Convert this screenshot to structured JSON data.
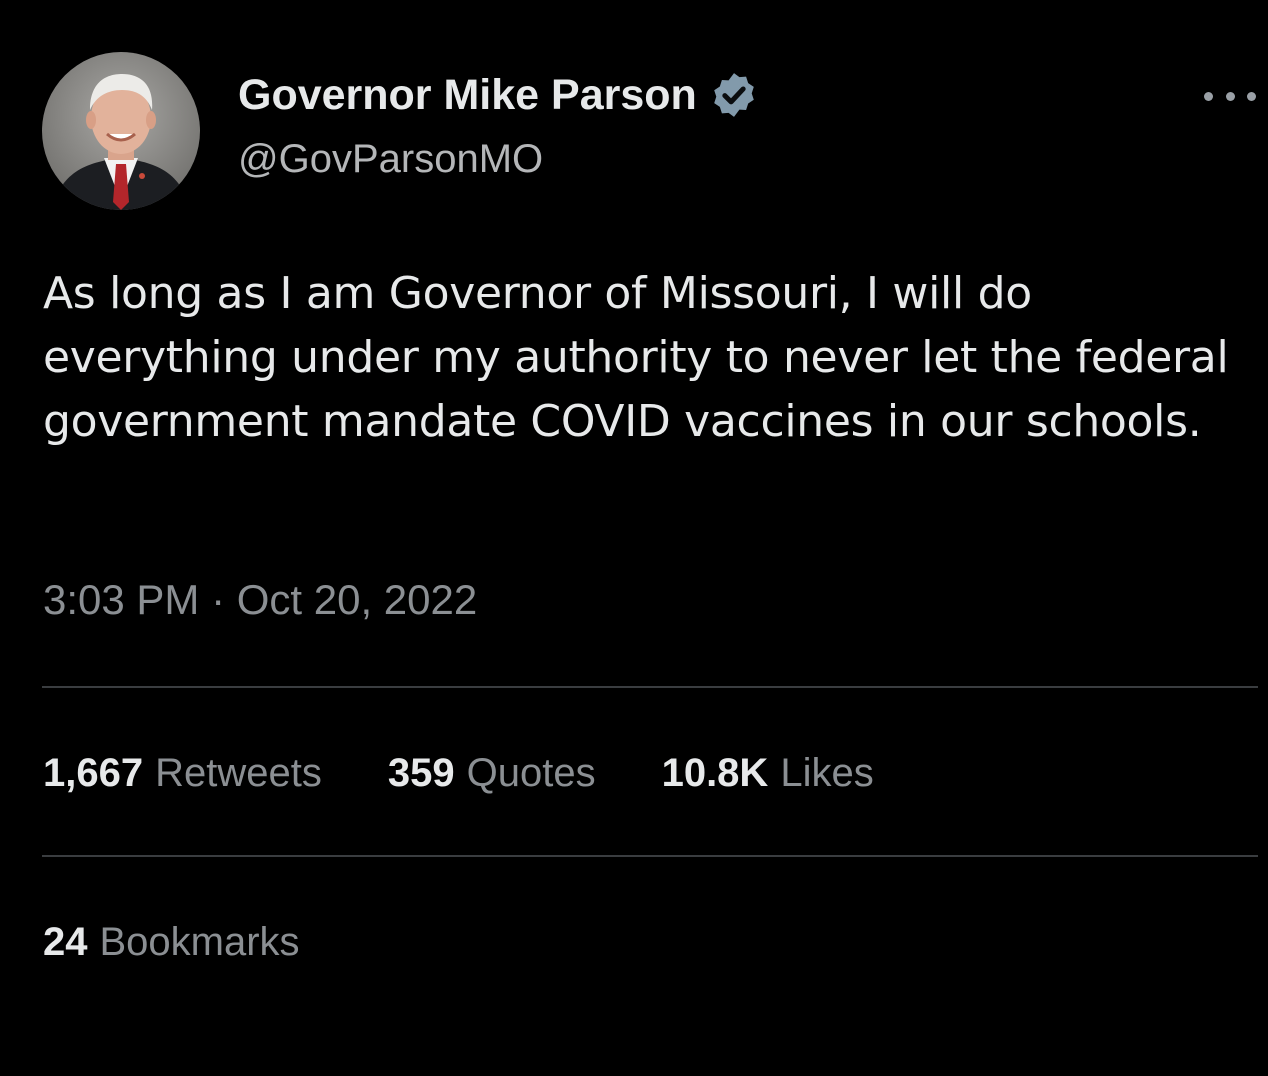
{
  "author": {
    "name": "Governor Mike Parson",
    "handle": "@GovParsonMO",
    "verified_badge_icon": "verified-check-icon",
    "verified_color": "#829aab"
  },
  "tweet": {
    "text": "As long as I am Governor of Missouri, I will do everything under my authority to never let the federal government mandate COVID vaccines in our schools.",
    "timestamp": "3:03 PM · Oct 20, 2022"
  },
  "stats": [
    {
      "count": "1,667",
      "label": "Retweets"
    },
    {
      "count": "359",
      "label": "Quotes"
    },
    {
      "count": "10.8K",
      "label": "Likes"
    }
  ],
  "bookmarks": {
    "count": "24",
    "label": "Bookmarks"
  },
  "colors": {
    "background": "#000000",
    "primary_text": "#e7e9ea",
    "secondary_text": "#8b8f93",
    "divider": "#3a3d40"
  }
}
